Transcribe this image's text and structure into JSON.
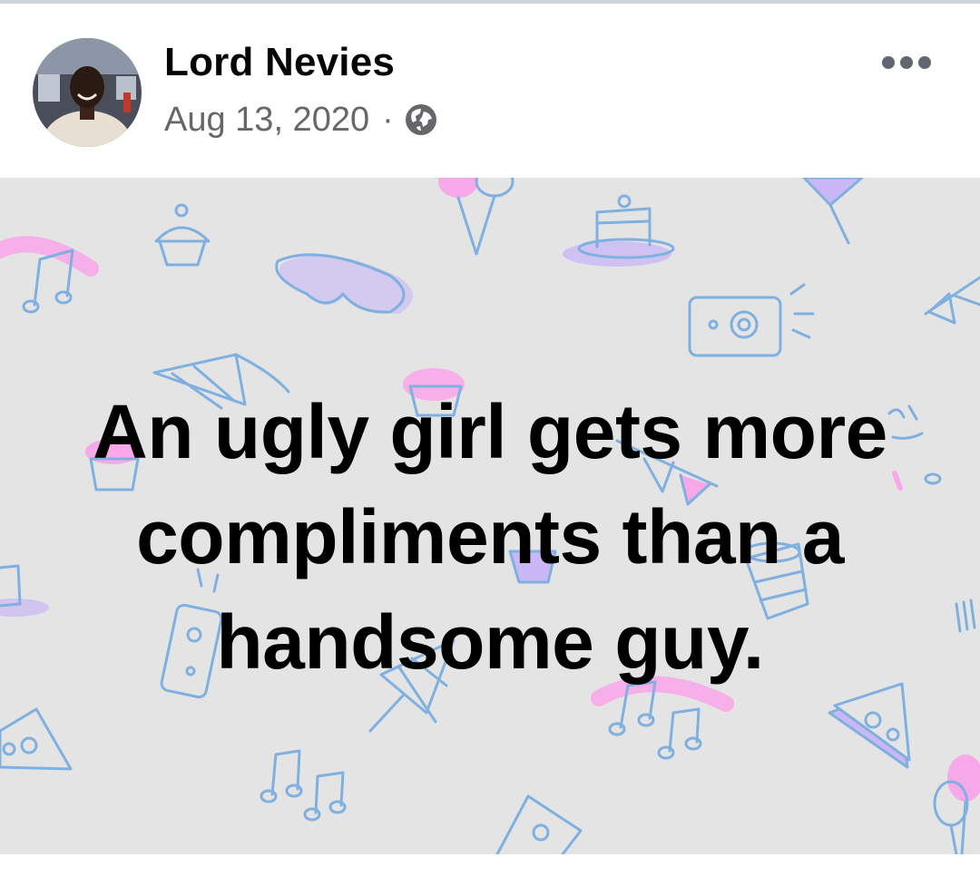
{
  "post": {
    "author": "Lord Nevies",
    "date": "Aug 13, 2020",
    "separator": "·",
    "audience_icon": "globe-icon",
    "more_icon": "more-options-icon",
    "text": "An ugly girl gets more compliments than a handsome guy.",
    "background_theme": "party-doodles"
  },
  "colors": {
    "doodle_stroke": "#7fb0e0",
    "doodle_pink": "#f7a8e8",
    "doodle_purple": "#c9b8f5",
    "post_background": "#e4e4e4",
    "meta_text": "#65676b"
  }
}
